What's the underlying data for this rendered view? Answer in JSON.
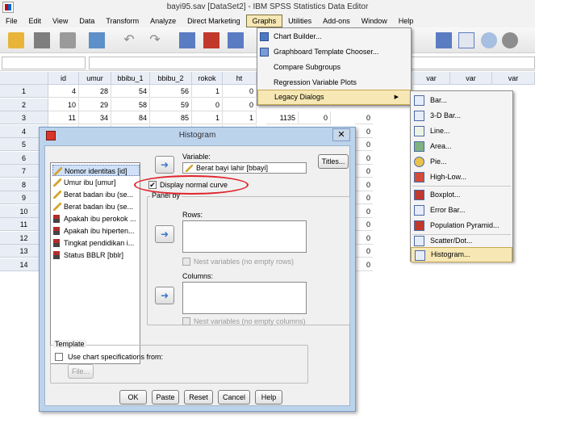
{
  "window": {
    "title": "bayi95.sav [DataSet2] - IBM SPSS Statistics Data Editor"
  },
  "menubar": [
    "File",
    "Edit",
    "View",
    "Data",
    "Transform",
    "Analyze",
    "Direct Marketing",
    "Graphs",
    "Utilities",
    "Add-ons",
    "Window",
    "Help"
  ],
  "grid": {
    "columns": [
      "id",
      "umur",
      "bbibu_1",
      "bbibu_2",
      "rokok",
      "ht"
    ],
    "extra_columns": [
      "var",
      "var",
      "var"
    ],
    "rows": [
      {
        "n": "1",
        "cells": [
          "4",
          "28",
          "54",
          "56",
          "1",
          "0"
        ]
      },
      {
        "n": "2",
        "cells": [
          "10",
          "29",
          "58",
          "59",
          "0",
          "0"
        ]
      },
      {
        "n": "3",
        "cells": [
          "11",
          "34",
          "84",
          "85",
          "1",
          "1"
        ]
      },
      {
        "n": "4",
        "cells": [
          "",
          "",
          "",
          "",
          "",
          ""
        ]
      },
      {
        "n": "5",
        "cells": [
          "",
          "",
          "",
          "",
          "",
          ""
        ]
      },
      {
        "n": "6",
        "cells": [
          "",
          "",
          "",
          "",
          "",
          ""
        ]
      },
      {
        "n": "7",
        "cells": [
          "",
          "",
          "",
          "",
          "",
          ""
        ]
      },
      {
        "n": "8",
        "cells": [
          "",
          "",
          "",
          "",
          "",
          ""
        ]
      },
      {
        "n": "9",
        "cells": [
          "",
          "",
          "",
          "",
          "",
          ""
        ]
      },
      {
        "n": "10",
        "cells": [
          "",
          "",
          "",
          "",
          "",
          ""
        ]
      },
      {
        "n": "11",
        "cells": [
          "",
          "",
          "",
          "",
          "",
          ""
        ]
      },
      {
        "n": "12",
        "cells": [
          "",
          "",
          "",
          "",
          "",
          ""
        ]
      },
      {
        "n": "13",
        "cells": [
          "",
          "",
          "",
          "",
          "",
          ""
        ]
      },
      {
        "n": "14",
        "cells": [
          "",
          "",
          "",
          "",
          "",
          ""
        ]
      }
    ],
    "row3_extra": [
      "1135",
      "0"
    ],
    "zero_col": [
      "0",
      "0",
      "0",
      "0",
      "0",
      "0",
      "0",
      "0",
      "0",
      "0",
      "0",
      "0"
    ]
  },
  "graphs_menu": {
    "items": [
      {
        "label": "Chart Builder..."
      },
      {
        "label": "Graphboard Template Chooser..."
      },
      {
        "label": "Compare Subgroups"
      },
      {
        "label": "Regression Variable Plots"
      },
      {
        "label": "Legacy Dialogs"
      }
    ]
  },
  "legacy_menu": {
    "items": [
      "Bar...",
      "3-D Bar...",
      "Line...",
      "Area...",
      "Pie...",
      "High-Low...",
      "Boxplot...",
      "Error Bar...",
      "Population Pyramid...",
      "Scatter/Dot...",
      "Histogram..."
    ]
  },
  "histogram": {
    "title": "Histogram",
    "variables": [
      "Nomor identitas [id]",
      "Umur ibu [umur]",
      "Berat badan ibu (se...",
      "Berat badan ibu (se...",
      "Apakah ibu perokok ...",
      "Apakah ibu hiperten...",
      "Tingkat pendidikan i...",
      "Status BBLR [bblr]"
    ],
    "variable_label": "Variable:",
    "variable_value": "Berat bayi lahir [bbayi]",
    "titles_button": "Titles...",
    "display_normal_curve": "Display normal curve",
    "panel_by": "Panel by",
    "rows_label": "Rows:",
    "nest_rows": "Nest variables (no empty rows)",
    "columns_label": "Columns:",
    "nest_columns": "Nest variables (no empty columns)",
    "template_label": "Template",
    "use_chart_spec": "Use chart specifications from:",
    "file_button": "File...",
    "buttons": {
      "ok": "OK",
      "paste": "Paste",
      "reset": "Reset",
      "cancel": "Cancel",
      "help": "Help"
    }
  }
}
